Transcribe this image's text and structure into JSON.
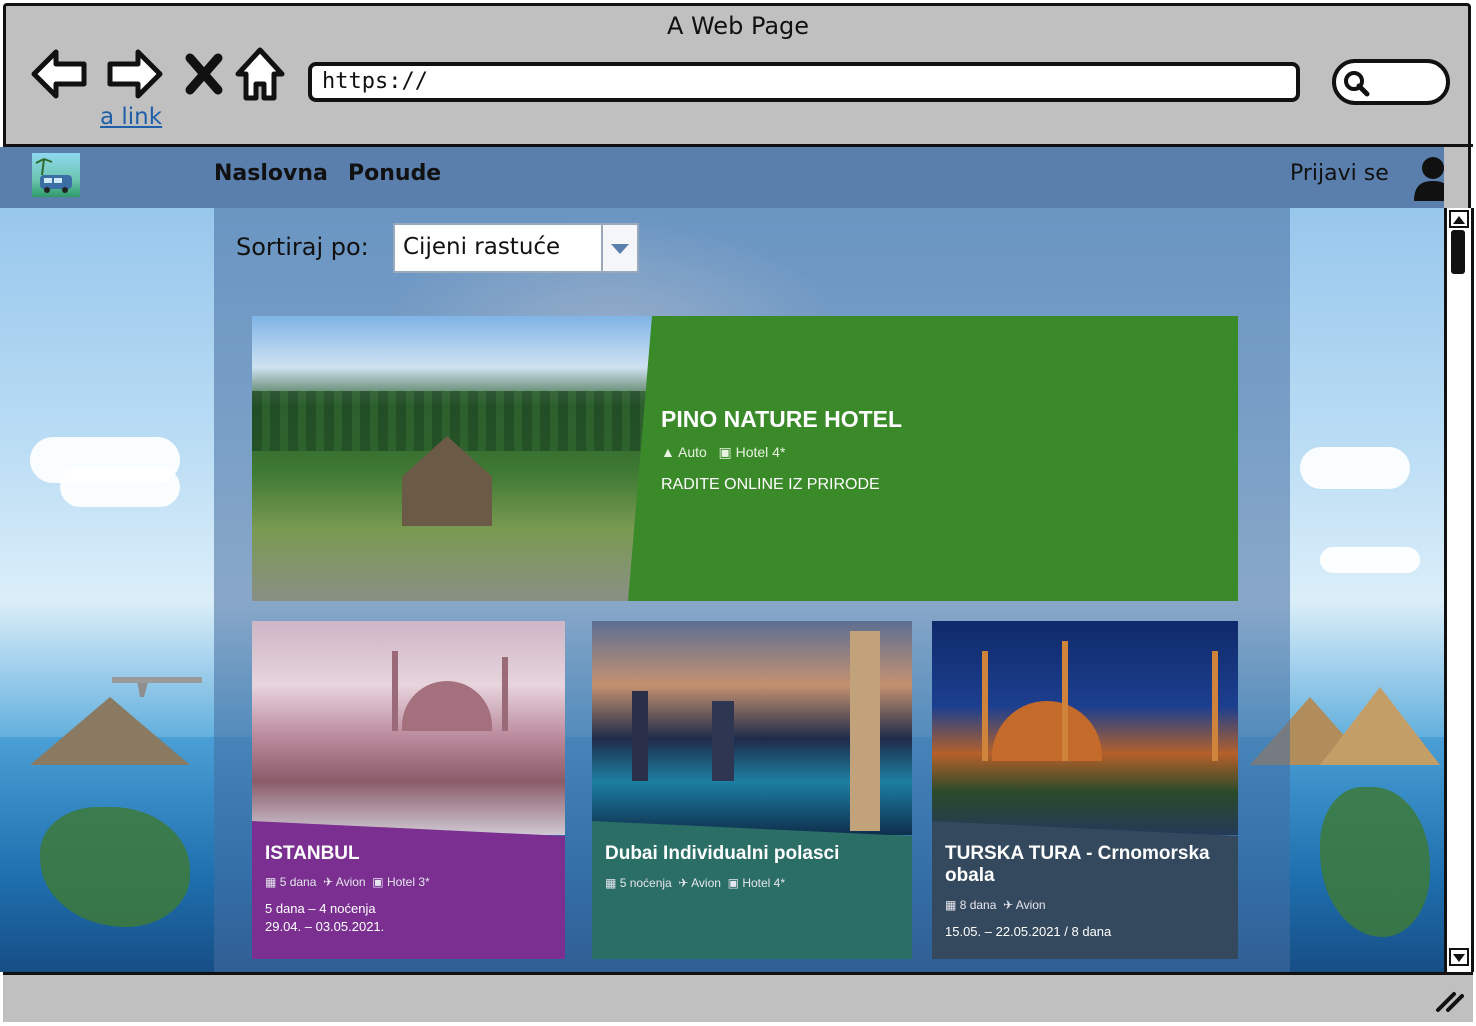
{
  "browser": {
    "title": "A Web Page",
    "url": "https://",
    "link_text": "a link",
    "icons": [
      "back-arrow-icon",
      "forward-arrow-icon",
      "close-x-icon",
      "home-icon",
      "search-icon"
    ]
  },
  "site": {
    "nav": {
      "home": "Naslovna",
      "offers": "Ponude"
    },
    "signin": "Prijavi se",
    "sort": {
      "label": "Sortiraj po:",
      "selected": "Cijeni rastuće"
    }
  },
  "hero": {
    "title": "PINO NATURE HOTEL",
    "meta": [
      {
        "icon": "road-icon",
        "text": "Auto"
      },
      {
        "icon": "bus-icon",
        "text": "Hotel 4*"
      }
    ],
    "description": "RADITE ONLINE IZ PRIRODE",
    "color": "#3a8a2a"
  },
  "cards": [
    {
      "title": "ISTANBUL",
      "meta": [
        {
          "icon": "calendar-icon",
          "text": "5 dana"
        },
        {
          "icon": "plane-icon",
          "text": "Avion"
        },
        {
          "icon": "bus-icon",
          "text": "Hotel 3*"
        }
      ],
      "lines": [
        "5 dana – 4 noćenja",
        "29.04. – 03.05.2021."
      ],
      "color": "#7a2f91"
    },
    {
      "title": "Dubai Individualni polasci",
      "meta": [
        {
          "icon": "calendar-icon",
          "text": "5 noćenja"
        },
        {
          "icon": "plane-icon",
          "text": "Avion"
        },
        {
          "icon": "bus-icon",
          "text": "Hotel 4*"
        }
      ],
      "lines": [],
      "color": "#2a6e66"
    },
    {
      "title": "TURSKA TURA - Crnomorska obala",
      "meta": [
        {
          "icon": "calendar-icon",
          "text": "8 dana"
        },
        {
          "icon": "plane-icon",
          "text": "Avion"
        }
      ],
      "lines": [
        "15.05. – 22.05.2021 / 8 dana"
      ],
      "color": "#34495e"
    }
  ],
  "colors": {
    "chrome": "#c0c0c0",
    "topnav": "#5a7fad",
    "link": "#1f5fa8"
  }
}
